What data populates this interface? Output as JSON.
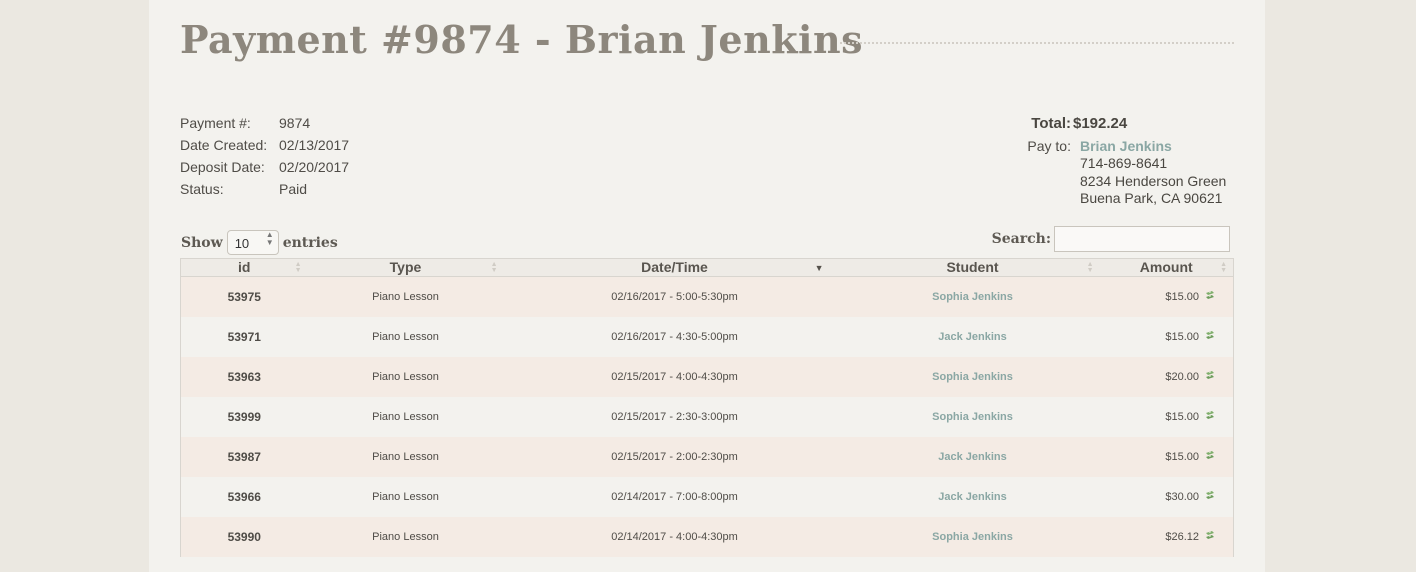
{
  "page": {
    "title": "Payment #9874 - Brian Jenkins"
  },
  "details": [
    {
      "label": "Payment #:",
      "value": "9874"
    },
    {
      "label": "Date Created:",
      "value": "02/13/2017"
    },
    {
      "label": "Deposit Date:",
      "value": "02/20/2017"
    },
    {
      "label": "Status:",
      "value": "Paid"
    }
  ],
  "summary": {
    "total_label": "Total:",
    "total_value": "$192.24",
    "payto_label": "Pay to:",
    "payto_name": "Brian Jenkins",
    "payto_phone": "714-869-8641",
    "payto_address1": "8234 Henderson Green",
    "payto_address2": "Buena Park, CA 90621"
  },
  "controls": {
    "show_label": "Show",
    "entries_label": "entries",
    "page_size": "10",
    "search_label": "Search:",
    "search_value": ""
  },
  "table": {
    "columns": [
      "id",
      "Type",
      "Date/Time",
      "Student",
      "Amount"
    ],
    "sorted_column": "Date/Time",
    "sort_direction": "descending",
    "rows": [
      {
        "id": "53975",
        "type": "Piano Lesson",
        "datetime": "02/16/2017 - 5:00-5:30pm",
        "student": "Sophia Jenkins",
        "amount": "$15.00"
      },
      {
        "id": "53971",
        "type": "Piano Lesson",
        "datetime": "02/16/2017 - 4:30-5:00pm",
        "student": "Jack Jenkins",
        "amount": "$15.00"
      },
      {
        "id": "53963",
        "type": "Piano Lesson",
        "datetime": "02/15/2017 - 4:00-4:30pm",
        "student": "Sophia Jenkins",
        "amount": "$20.00"
      },
      {
        "id": "53999",
        "type": "Piano Lesson",
        "datetime": "02/15/2017 - 2:30-3:00pm",
        "student": "Sophia Jenkins",
        "amount": "$15.00"
      },
      {
        "id": "53987",
        "type": "Piano Lesson",
        "datetime": "02/15/2017 - 2:00-2:30pm",
        "student": "Jack Jenkins",
        "amount": "$15.00"
      },
      {
        "id": "53966",
        "type": "Piano Lesson",
        "datetime": "02/14/2017 - 7:00-8:00pm",
        "student": "Jack Jenkins",
        "amount": "$30.00"
      },
      {
        "id": "53990",
        "type": "Piano Lesson",
        "datetime": "02/14/2017 - 4:00-4:30pm",
        "student": "Sophia Jenkins",
        "amount": "$26.12"
      }
    ]
  },
  "icons": {
    "amount_icon": "money-icon"
  },
  "colors": {
    "link": "#8aa7a4",
    "title": "#8d877d",
    "money_icon": "#7fae6b"
  }
}
